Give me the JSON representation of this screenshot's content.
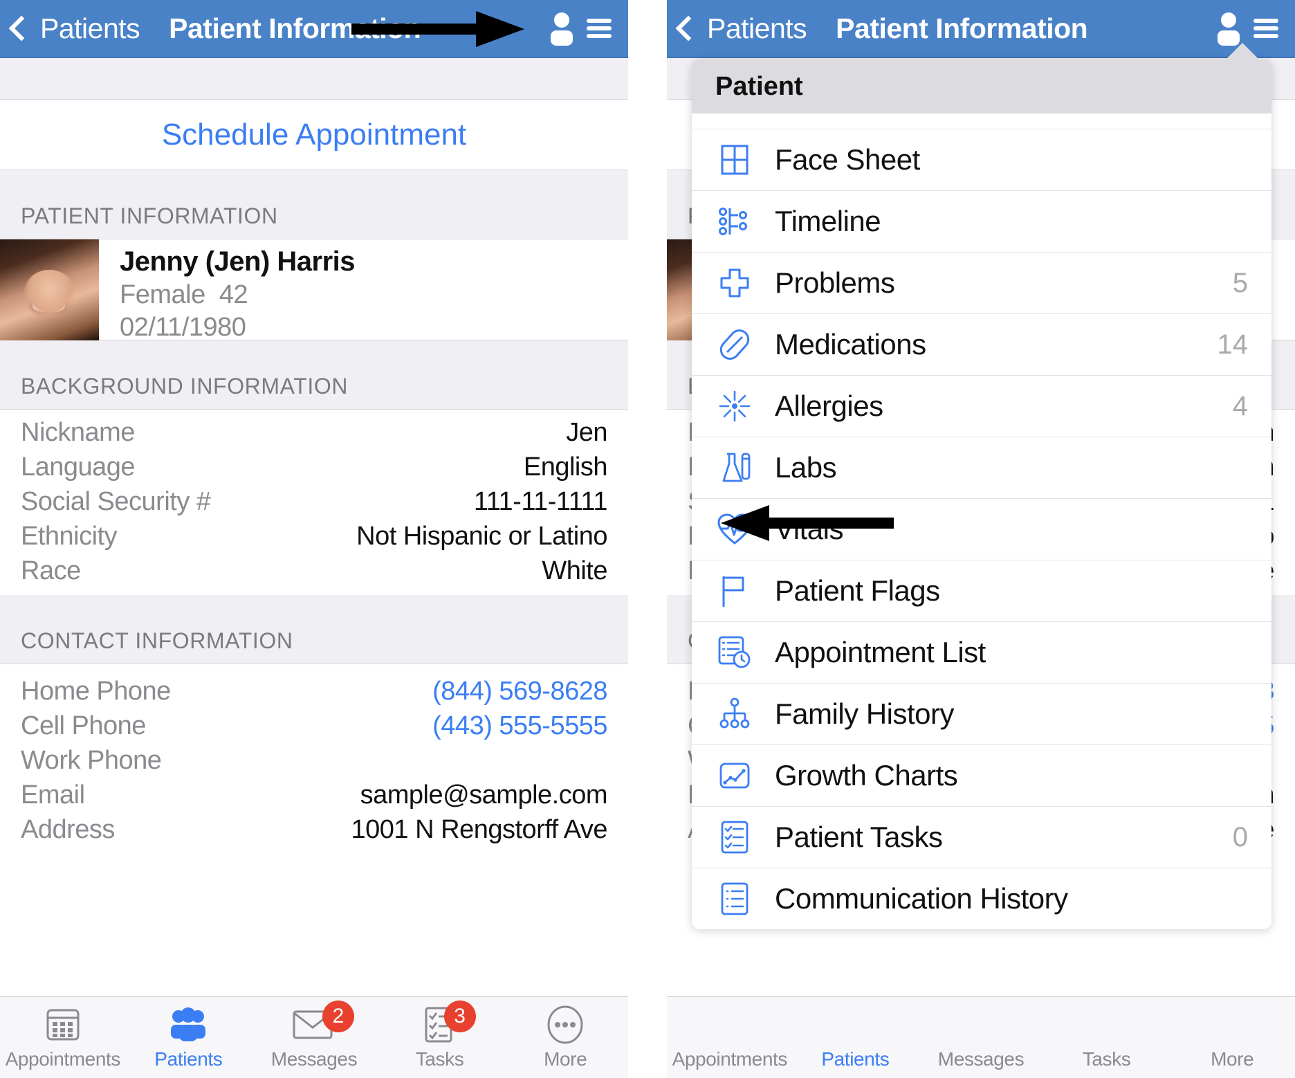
{
  "navbar": {
    "back_label": "Patients",
    "title": "Patient Information",
    "person_icon": "person-icon",
    "menu_icon": "hamburger-icon"
  },
  "left_panel": {
    "schedule_button": "Schedule Appointment",
    "sections": [
      {
        "header": "PATIENT INFORMATION",
        "patient": {
          "name": "Jenny (Jen) Harris",
          "gender": "Female",
          "age": "42",
          "dob": "02/11/1980"
        }
      },
      {
        "header": "BACKGROUND INFORMATION",
        "rows": [
          {
            "key": "Nickname",
            "value": "Jen",
            "link": false
          },
          {
            "key": "Language",
            "value": "English",
            "link": false
          },
          {
            "key": "Social Security #",
            "value": "111-11-1111",
            "link": false
          },
          {
            "key": "Ethnicity",
            "value": "Not Hispanic or Latino",
            "link": false
          },
          {
            "key": "Race",
            "value": "White",
            "link": false
          }
        ]
      },
      {
        "header": "CONTACT INFORMATION",
        "rows": [
          {
            "key": "Home Phone",
            "value": "(844) 569-8628",
            "link": true
          },
          {
            "key": "Cell Phone",
            "value": "(443) 555-5555",
            "link": true
          },
          {
            "key": "Work Phone",
            "value": "",
            "link": false
          },
          {
            "key": "Email",
            "value": "sample@sample.com",
            "link": false
          },
          {
            "key": "Address",
            "value": "1001 N Rengstorff Ave",
            "link": false
          }
        ]
      }
    ]
  },
  "tabbar": {
    "tabs": [
      {
        "label": "Appointments",
        "icon": "calendar-icon",
        "badge": "",
        "active": false
      },
      {
        "label": "Patients",
        "icon": "people-icon",
        "badge": "",
        "active": true
      },
      {
        "label": "Messages",
        "icon": "envelope-icon",
        "badge": "2",
        "active": false
      },
      {
        "label": "Tasks",
        "icon": "checklist-icon",
        "badge": "3",
        "active": false
      },
      {
        "label": "More",
        "icon": "ellipsis-icon",
        "badge": "",
        "active": false
      }
    ]
  },
  "popup": {
    "title": "Patient",
    "items": [
      {
        "label": "Face Sheet",
        "icon": "grid-icon",
        "count": ""
      },
      {
        "label": "Timeline",
        "icon": "timeline-icon",
        "count": ""
      },
      {
        "label": "Problems",
        "icon": "cross-icon",
        "count": "5"
      },
      {
        "label": "Medications",
        "icon": "pill-icon",
        "count": "14"
      },
      {
        "label": "Allergies",
        "icon": "allergy-burst-icon",
        "count": "4"
      },
      {
        "label": "Labs",
        "icon": "flask-icon",
        "count": ""
      },
      {
        "label": "Vitals",
        "icon": "heart-pulse-icon",
        "count": ""
      },
      {
        "label": "Patient Flags",
        "icon": "flag-icon",
        "count": ""
      },
      {
        "label": "Appointment List",
        "icon": "appointment-list-icon",
        "count": ""
      },
      {
        "label": "Family History",
        "icon": "family-tree-icon",
        "count": ""
      },
      {
        "label": "Growth Charts",
        "icon": "growth-chart-icon",
        "count": ""
      },
      {
        "label": "Patient Tasks",
        "icon": "patient-tasks-icon",
        "count": "0"
      },
      {
        "label": "Communication History",
        "icon": "communication-history-icon",
        "count": ""
      }
    ]
  },
  "annotations": {
    "left_arrow_target": "person-and-menu-icons",
    "right_arrow_target": "Vitals"
  },
  "colors": {
    "nav_blue": "#4a82c8",
    "link_blue": "#3b7ef4",
    "icon_blue": "#3b7ef4",
    "badge_red": "#e8412f",
    "section_gray": "#f0f0f4",
    "popup_header_gray": "#dcdce0"
  }
}
